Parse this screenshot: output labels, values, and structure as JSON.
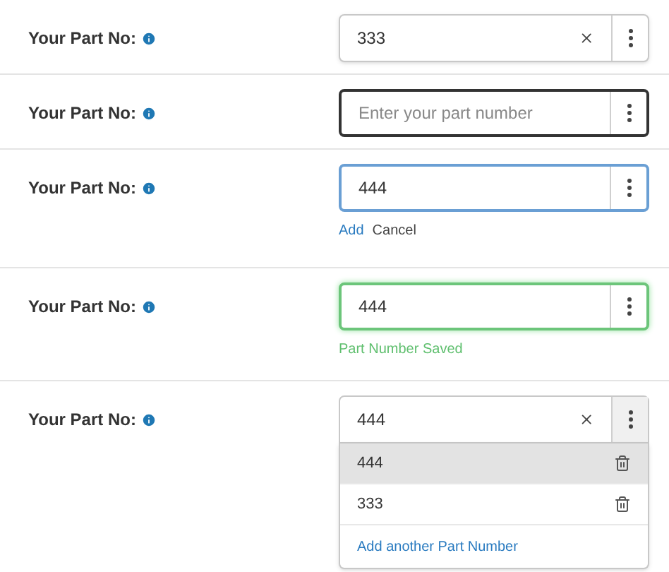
{
  "rows": [
    {
      "label": "Your Part No:",
      "kind": "default",
      "value": "333",
      "clearable": true
    },
    {
      "label": "Your Part No:",
      "kind": "focused",
      "placeholder": "Enter your part number",
      "clearable": false
    },
    {
      "label": "Your Part No:",
      "kind": "editing",
      "value": "444",
      "clearable": false,
      "actions": [
        {
          "label": "Add",
          "kind": "link"
        },
        {
          "label": "Cancel",
          "kind": "plain"
        }
      ]
    },
    {
      "label": "Your Part No:",
      "kind": "saved",
      "value": "444",
      "clearable": false,
      "message": "Part Number Saved"
    },
    {
      "label": "Your Part No:",
      "kind": "open",
      "value": "444",
      "clearable": true,
      "options": [
        {
          "label": "444",
          "selected": true
        },
        {
          "label": "333",
          "selected": false
        }
      ],
      "add_link": "Add another Part Number"
    }
  ]
}
